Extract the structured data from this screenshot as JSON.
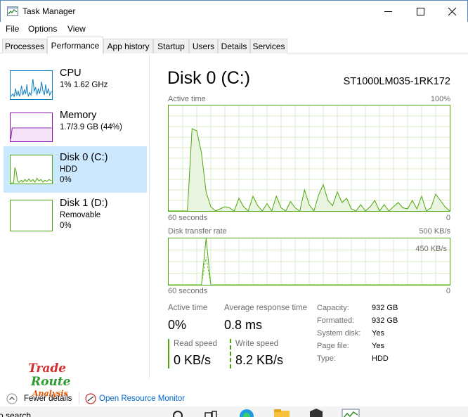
{
  "window": {
    "title": "Task Manager"
  },
  "menu": [
    "File",
    "Options",
    "View"
  ],
  "tabs": [
    "Processes",
    "Performance",
    "App history",
    "Startup",
    "Users",
    "Details",
    "Services"
  ],
  "sidebar": {
    "items": [
      {
        "title": "CPU",
        "line1": "1% 1.62 GHz",
        "line2": ""
      },
      {
        "title": "Memory",
        "line1": "1.7/3.9 GB (44%)",
        "line2": ""
      },
      {
        "title": "Disk 0 (C:)",
        "line1": "HDD",
        "line2": "0%"
      },
      {
        "title": "Disk 1 (D:)",
        "line1": "Removable",
        "line2": "0%"
      }
    ]
  },
  "main": {
    "title": "Disk 0 (C:)",
    "model": "ST1000LM035-1RK172",
    "active_graph": {
      "label": "Active time",
      "max": "100%",
      "x_left": "60 seconds",
      "x_right": "0",
      "values": [
        0,
        0,
        0,
        0,
        0,
        78,
        76,
        55,
        18,
        4,
        0,
        2,
        4,
        3,
        0,
        12,
        4,
        0,
        14,
        5,
        0,
        7,
        0,
        14,
        3,
        0,
        9,
        3,
        0,
        20,
        6,
        0,
        15,
        25,
        10,
        5,
        18,
        8,
        12,
        2,
        0,
        6,
        0,
        4,
        10,
        0,
        6,
        0,
        4,
        8,
        3,
        2,
        10,
        2,
        14,
        0,
        3,
        16,
        10,
        4,
        0
      ]
    },
    "transfer_graph": {
      "label": "Disk transfer rate",
      "max": "500 KB/s",
      "inner": "450 KB/s",
      "x_left": "60 seconds",
      "x_right": "0",
      "series": [
        {
          "values": [
            0,
            0,
            0,
            0,
            0,
            0,
            0,
            0,
            100,
            0,
            0,
            0,
            0,
            0,
            0,
            0,
            0,
            0,
            0,
            0,
            0,
            0,
            0,
            0,
            0,
            0,
            0,
            0,
            0,
            0,
            0,
            0,
            0,
            0,
            0,
            0,
            0,
            0,
            0,
            0,
            0,
            0,
            0,
            0,
            0,
            0,
            0,
            0,
            0,
            0,
            0,
            0,
            0,
            0,
            0,
            0,
            0,
            0,
            0,
            0,
            0
          ]
        },
        {
          "values": [
            0,
            0,
            0,
            0,
            0,
            0,
            0,
            0,
            60,
            0,
            0,
            0,
            0,
            0,
            0,
            0,
            0,
            0,
            0,
            0,
            0,
            0,
            0,
            0,
            0,
            0,
            0,
            0,
            0,
            0,
            0,
            0,
            0,
            0,
            0,
            0,
            0,
            0,
            0,
            0,
            0,
            0,
            0,
            0,
            0,
            0,
            0,
            0,
            0,
            0,
            0,
            0,
            0,
            0,
            0,
            0,
            0,
            0,
            0,
            0,
            0
          ]
        }
      ]
    },
    "stats": {
      "active_time": {
        "label": "Active time",
        "value": "0%"
      },
      "avg_response": {
        "label": "Average response time",
        "value": "0.8 ms"
      },
      "read_speed": {
        "label": "Read speed",
        "value": "0 KB/s"
      },
      "write_speed": {
        "label": "Write speed",
        "value": "8.2 KB/s"
      }
    },
    "properties": [
      {
        "label": "Capacity:",
        "value": "932 GB"
      },
      {
        "label": "Formatted:",
        "value": "932 GB"
      },
      {
        "label": "System disk:",
        "value": "Yes"
      },
      {
        "label": "Page file:",
        "value": "Yes"
      },
      {
        "label": "Type:",
        "value": "HDD"
      }
    ]
  },
  "footer": {
    "fewer_details": "Fewer details",
    "resource_monitor": "Open Resource Monitor"
  },
  "taskbar": {
    "search_text": "o search"
  },
  "watermark": {
    "line1": "Trade",
    "line2": "Route",
    "line3": "Analysis"
  },
  "colors": {
    "disk_green": "#4da60c",
    "cpu_blue": "#117dbb",
    "memory_purple": "#8b12ae",
    "selected_bg": "#cce8ff",
    "link_blue": "#0066cc"
  }
}
